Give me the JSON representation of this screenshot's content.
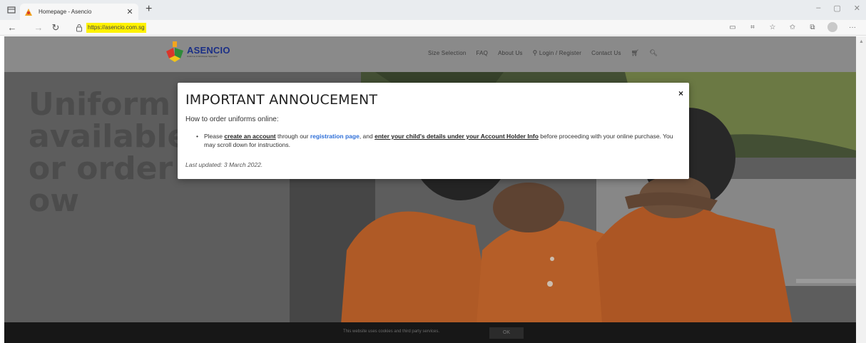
{
  "browser": {
    "tab_title": "Homepage - Asencio",
    "new_tab_symbol": "+",
    "url": "https://asencio.com.sg",
    "window_controls": [
      "–",
      "▢",
      "✕"
    ],
    "toolbar_icons": [
      "reader-icon",
      "translate-icon",
      "favorites-add-icon",
      "favorites-icon",
      "collections-icon",
      "profile-icon",
      "more-icon"
    ],
    "more_label": "···"
  },
  "site": {
    "logo_text": "ASENCIO",
    "logo_tagline": "Uniforms & Workwear Specialist",
    "nav": {
      "size_selection": "Size Selection",
      "faq": "FAQ",
      "about": "About Us",
      "login": "Login / Register",
      "contact": "Contact Us"
    },
    "headline": "Uniform is available for order now"
  },
  "modal": {
    "title": "IMPORTANT ANNOUCEMENT",
    "close": "×",
    "subtitle": "How to order uniforms online:",
    "bullet": {
      "t1": "Please ",
      "link1": "create an account",
      "t2": " through our ",
      "link2": "registration page",
      "t3": ",  and ",
      "link3": "enter your child's details under your Account Holder Info",
      "t4": " before proceeding with your online purchase. You may scroll down for instructions."
    },
    "updated": "Last updated: 3 March 2022."
  },
  "cookie": {
    "text": "This website uses cookies and third party services.",
    "ok": "OK"
  },
  "colors": {
    "url_highlight": "#fff200",
    "logo_blue": "#1b2f86",
    "link_blue": "#2e6fd8",
    "shirt_orange": "#e9772e"
  }
}
